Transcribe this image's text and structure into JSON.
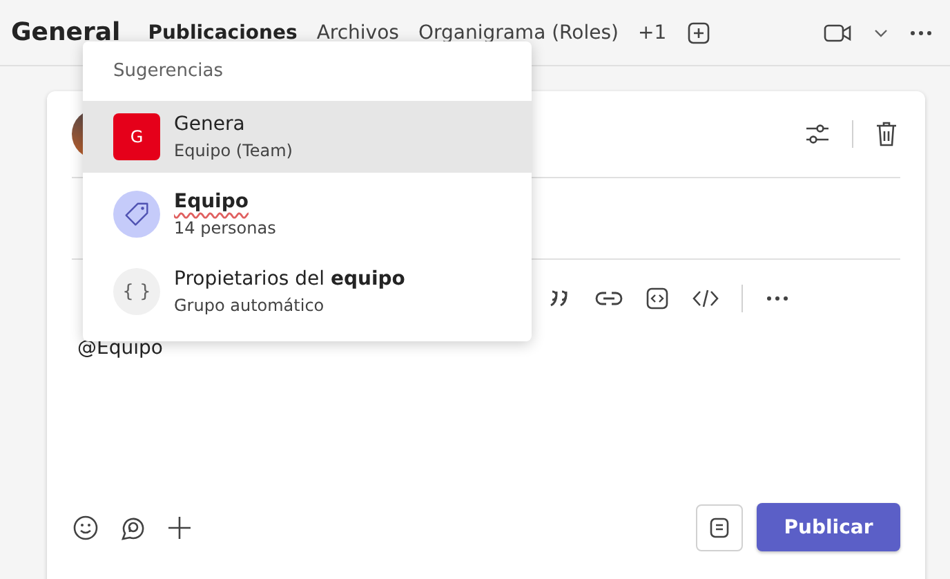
{
  "channel_title": "General",
  "tabs": [
    {
      "label": "Publicaciones",
      "selected": true
    },
    {
      "label": "Archivos",
      "selected": false
    },
    {
      "label": "Organigrama (Roles)",
      "selected": false
    }
  ],
  "more_tabs": "+1",
  "suggestions": {
    "heading": "Sugerencias",
    "items": [
      {
        "kind": "team",
        "badge": "G",
        "title": "Genera",
        "subtitle": "Equipo (Team)",
        "selected": true,
        "spelling_error": false
      },
      {
        "kind": "tag",
        "title": "Equipo",
        "subtitle": "14 personas",
        "selected": false,
        "spelling_error": true
      },
      {
        "kind": "group",
        "badge": "{ }",
        "title": "Propietarios del **equipo**",
        "subtitle": "Grupo automático",
        "selected": false,
        "spelling_error": false
      }
    ]
  },
  "editor": {
    "value": "@Equipo"
  },
  "post_button": "Publicar"
}
